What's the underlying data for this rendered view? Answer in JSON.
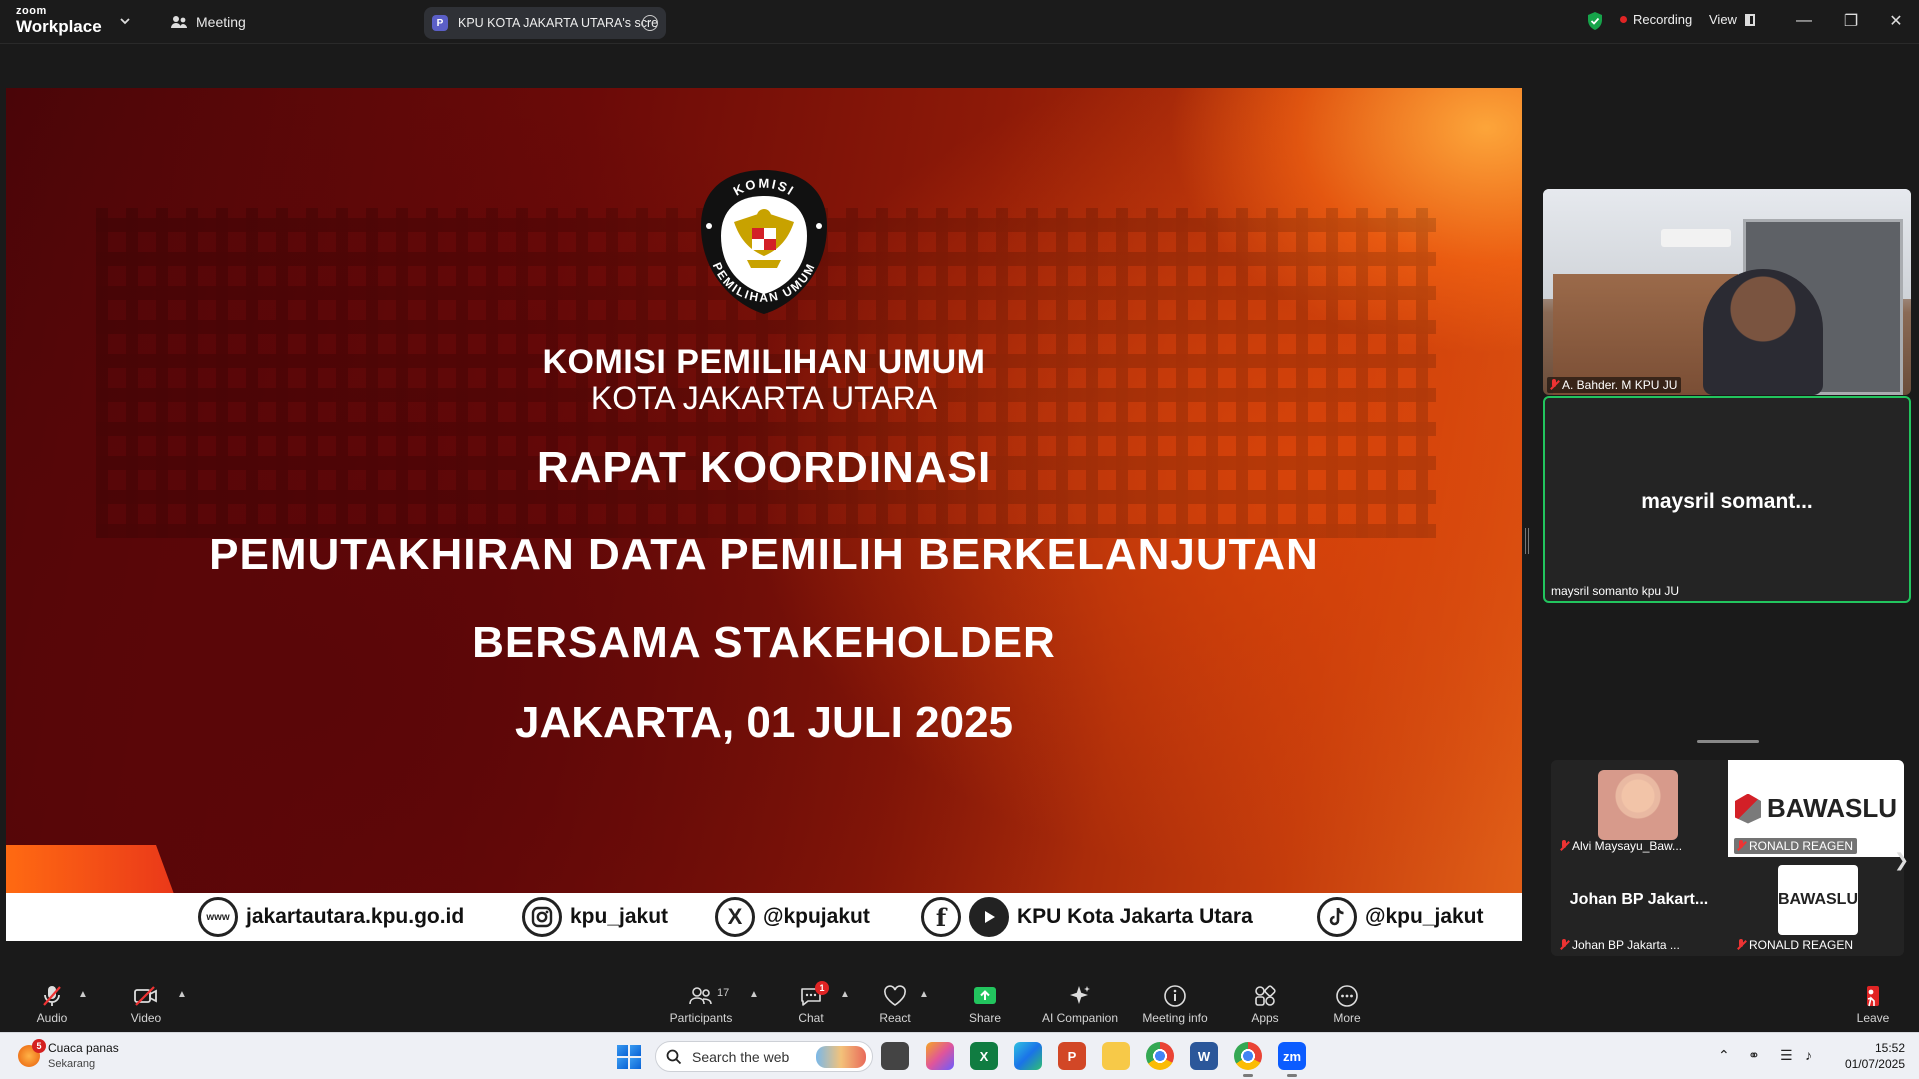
{
  "titlebar": {
    "brand_top": "zoom",
    "brand_bottom": "Workplace",
    "meeting_tab": "Meeting",
    "share_tab_badge": "P",
    "share_tab_label": "KPU KOTA JAKARTA UTARA's scre",
    "recording_label": "Recording",
    "view_label": "View"
  },
  "slide": {
    "emblem_top": "KOMISI",
    "emblem_bottom": "PEMILIHAN UMUM",
    "org_line1": "KOMISI PEMILIHAN UMUM",
    "org_line2": "KOTA JAKARTA UTARA",
    "heading1": "RAPAT KOORDINASI",
    "heading2": "PEMUTAKHIRAN DATA PEMILIH BERKELANJUTAN",
    "heading3": "BERSAMA STAKEHOLDER",
    "date_line": "JAKARTA, 01 JULI 2025",
    "footer": {
      "website_icon": "www",
      "website": "jakartautara.kpu.go.id",
      "instagram": "kpu_jakut",
      "x_icon": "X",
      "x_handle": "@kpujakut",
      "facebook_icon": "f",
      "youtube": "KPU Kota Jakarta Utara",
      "tiktok": "@kpu_jakut"
    }
  },
  "participants_panel": {
    "tile1_label": "A. Bahder. M KPU JU",
    "tile2_name": "maysril  somant...",
    "tile2_label": "maysril somanto kpu JU",
    "gallery": [
      {
        "label": "Alvi Maysayu_Baw..."
      },
      {
        "label": "RONALD REAGEN",
        "logo_text": "BAWASLU"
      },
      {
        "name": "Johan BP Jakart...",
        "label": "Johan BP Jakarta ..."
      },
      {
        "label": "RONALD REAGEN",
        "logo_text": "BAWASLU"
      }
    ]
  },
  "toolbar": {
    "audio": "Audio",
    "video": "Video",
    "participants": "Participants",
    "participants_count": "17",
    "chat": "Chat",
    "chat_badge": "1",
    "react": "React",
    "share": "Share",
    "ai_companion": "AI Companion",
    "meeting_info": "Meeting info",
    "apps": "Apps",
    "more": "More",
    "leave": "Leave"
  },
  "taskbar": {
    "weather_title": "Cuaca panas",
    "weather_sub": "Sekarang",
    "weather_badge": "5",
    "search_placeholder": "Search the web",
    "time": "15:52",
    "date": "01/07/2025"
  }
}
